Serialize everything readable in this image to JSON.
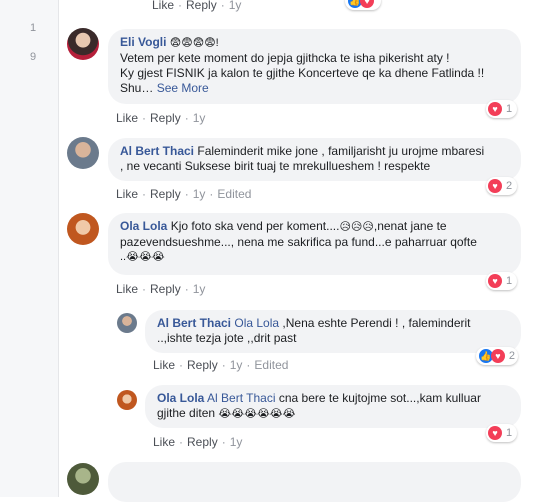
{
  "gutter": {
    "numbers": [
      "1",
      "9"
    ]
  },
  "top_row": {
    "like": "Like",
    "reply": "Reply",
    "time": "1y"
  },
  "comments": [
    {
      "author": "Eli Vogli",
      "emojis": "😨😨😨😨!",
      "line1": "Vetem per kete moment do jepja gjithcka te isha pikerisht aty !",
      "line2": "Ky gjest FISNIK ja kalon te gjithe Koncerteve qe ka dhene Fatlinda !!",
      "line3": "Shu…",
      "see_more": "See More",
      "like": "Like",
      "reply": "Reply",
      "time": "1y",
      "reaction_count": "1"
    },
    {
      "author": "Al Bert Thaci",
      "line1": "Faleminderit mike jone , familjarisht ju urojme mbaresi",
      "line2": ", ne vecanti Suksese birit tuaj te mrekullueshem ! respekte",
      "like": "Like",
      "reply": "Reply",
      "time": "1y",
      "edited": "Edited",
      "reaction_count": "2"
    },
    {
      "author": "Ola Lola",
      "line1": "Kjo foto ska vend per koment....",
      "line1_emoji": "😥😥😥",
      "line1_tail": ",nenat jane te",
      "line2": "pazevendsueshme..., nena me sakrifica pa fund...e paharruar qofte",
      "line3": "..😭😭😭",
      "like": "Like",
      "reply": "Reply",
      "time": "1y",
      "reaction_count": "1"
    }
  ],
  "replies": [
    {
      "author": "Al Bert Thaci",
      "mention": "Ola Lola",
      "line1": ",Nena eshte Perendi ! , faleminderit",
      "line2": "..,ishte tezja jote ,,drit past",
      "like": "Like",
      "reply": "Reply",
      "time": "1y",
      "edited": "Edited",
      "reaction_count": "2"
    },
    {
      "author": "Ola Lola",
      "mention": "Al Bert Thaci",
      "line1": "cna bere te kujtojme sot...,kam kulluar",
      "line2": "gjithe diten",
      "line2_emoji": "😭😭😭😭😭😭",
      "like": "Like",
      "reply": "Reply",
      "time": "1y",
      "reaction_count": "1"
    }
  ],
  "colors": {
    "link": "#385898",
    "bubble": "#f2f3f5",
    "heart": "#f33e58",
    "like": "#1877f2"
  }
}
